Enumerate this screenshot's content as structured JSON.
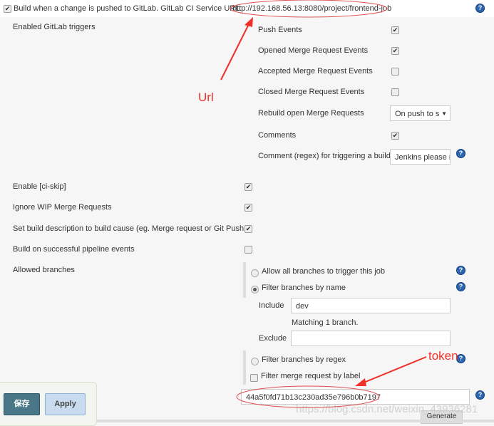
{
  "trigger": {
    "label": "Build when a change is pushed to GitLab. GitLab CI Service URL:",
    "url": "http://192.168.56.13:8080/project/frontend-job",
    "checked": true
  },
  "gitlab_triggers": {
    "label": "Enabled GitLab triggers",
    "items": [
      {
        "label": "Push Events",
        "checked": true
      },
      {
        "label": "Opened Merge Request Events",
        "checked": true
      },
      {
        "label": "Accepted Merge Request Events",
        "checked": false
      },
      {
        "label": "Closed Merge Request Events",
        "checked": false
      }
    ],
    "rebuild_label": "Rebuild open Merge Requests",
    "rebuild_value": "On push to s",
    "comments_label": "Comments",
    "comments_checked": true,
    "regex_label": "Comment (regex) for triggering a build",
    "regex_value": "Jenkins please r"
  },
  "options": [
    {
      "label": "Enable [ci-skip]",
      "checked": true
    },
    {
      "label": "Ignore WIP Merge Requests",
      "checked": true
    },
    {
      "label": "Set build description to build cause (eg. Merge request or Git Push )",
      "checked": true
    },
    {
      "label": "Build on successful pipeline events",
      "checked": false
    }
  ],
  "branches": {
    "label": "Allowed branches",
    "allow_all": "Allow all branches to trigger this job",
    "by_name": "Filter branches by name",
    "include_label": "Include",
    "include_value": "dev",
    "matching": "Matching 1 branch.",
    "exclude_label": "Exclude",
    "exclude_value": "",
    "by_regex": "Filter branches by regex",
    "by_label": "Filter merge request by label"
  },
  "token": {
    "value": "44a5f0fd71b13c230ad35e796b0b7197",
    "generate": "Generate"
  },
  "buttons": {
    "save": "保存",
    "apply": "Apply"
  },
  "annotations": {
    "url": "Url",
    "token": "token"
  },
  "watermark": "https://blog.csdn.net/weixin_43936281"
}
